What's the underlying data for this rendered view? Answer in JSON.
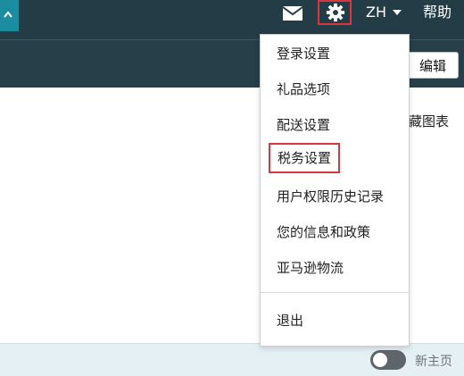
{
  "header": {
    "language": "ZH",
    "help": "帮助",
    "icons": [
      "back-arrow-icon",
      "mail-icon",
      "gear-icon",
      "caret-down-icon"
    ]
  },
  "toolbar": {
    "edit_label": "编辑",
    "favorites_text": "藏图表"
  },
  "settings_menu": {
    "items": [
      {
        "label": "登录设置"
      },
      {
        "label": "礼品选项"
      },
      {
        "label": "配送设置"
      },
      {
        "label": "税务设置",
        "highlighted": true
      },
      {
        "label": "用户权限历史记录"
      },
      {
        "label": "您的信息和政策"
      },
      {
        "label": "亚马逊物流"
      }
    ],
    "logout_label": "退出"
  },
  "footer": {
    "new_home_label": "新主页",
    "new_home_enabled": false
  },
  "colors": {
    "header_bg": "#243c45",
    "accent_teal": "#1b8da0",
    "highlight_red": "#d8373f",
    "footer_bg": "#e5f0f4"
  }
}
